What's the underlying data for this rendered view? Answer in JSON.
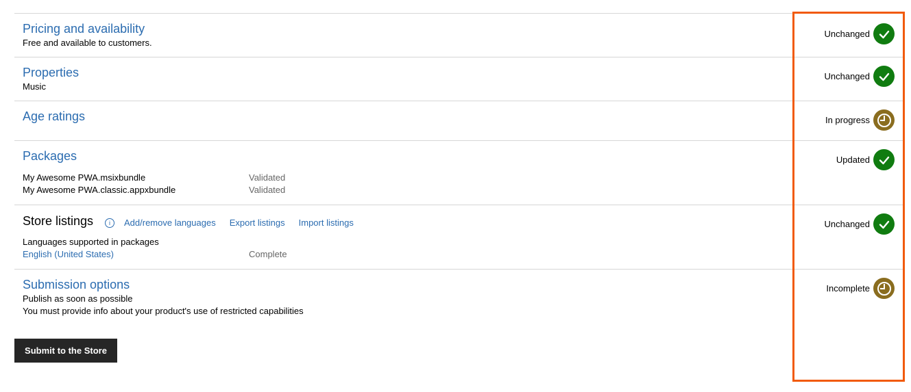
{
  "sections": {
    "pricing": {
      "title": "Pricing and availability",
      "subtitle": "Free and available to customers.",
      "status": "Unchanged",
      "status_icon": "checkmark-icon"
    },
    "properties": {
      "title": "Properties",
      "subtitle": "Music",
      "status": "Unchanged",
      "status_icon": "checkmark-icon"
    },
    "age_ratings": {
      "title": "Age ratings",
      "status": "In progress",
      "status_icon": "clock-progress-icon"
    },
    "packages": {
      "title": "Packages",
      "items": [
        {
          "name": "My Awesome PWA.msixbundle",
          "state": "Validated"
        },
        {
          "name": "My Awesome PWA.classic.appxbundle",
          "state": "Validated"
        }
      ],
      "status": "Updated",
      "status_icon": "checkmark-icon"
    },
    "store_listings": {
      "title": "Store listings",
      "info_icon": "info-icon",
      "links": {
        "add_remove": "Add/remove languages",
        "export": "Export listings",
        "import": "Import listings"
      },
      "languages_label": "Languages supported in packages",
      "language": {
        "name": "English (United States)",
        "state": "Complete"
      },
      "status": "Unchanged",
      "status_icon": "checkmark-icon"
    },
    "submission_options": {
      "title": "Submission options",
      "line1": "Publish as soon as possible",
      "line2": "You must provide info about your product's use of restricted capabilities",
      "status": "Incomplete",
      "status_icon": "clock-progress-icon"
    }
  },
  "submit_button": "Submit to the Store",
  "colors": {
    "link": "#2b6cb0",
    "ok": "#107c10",
    "progress": "#8a6d1f",
    "highlight": "#f15a0a",
    "button": "#262626"
  }
}
